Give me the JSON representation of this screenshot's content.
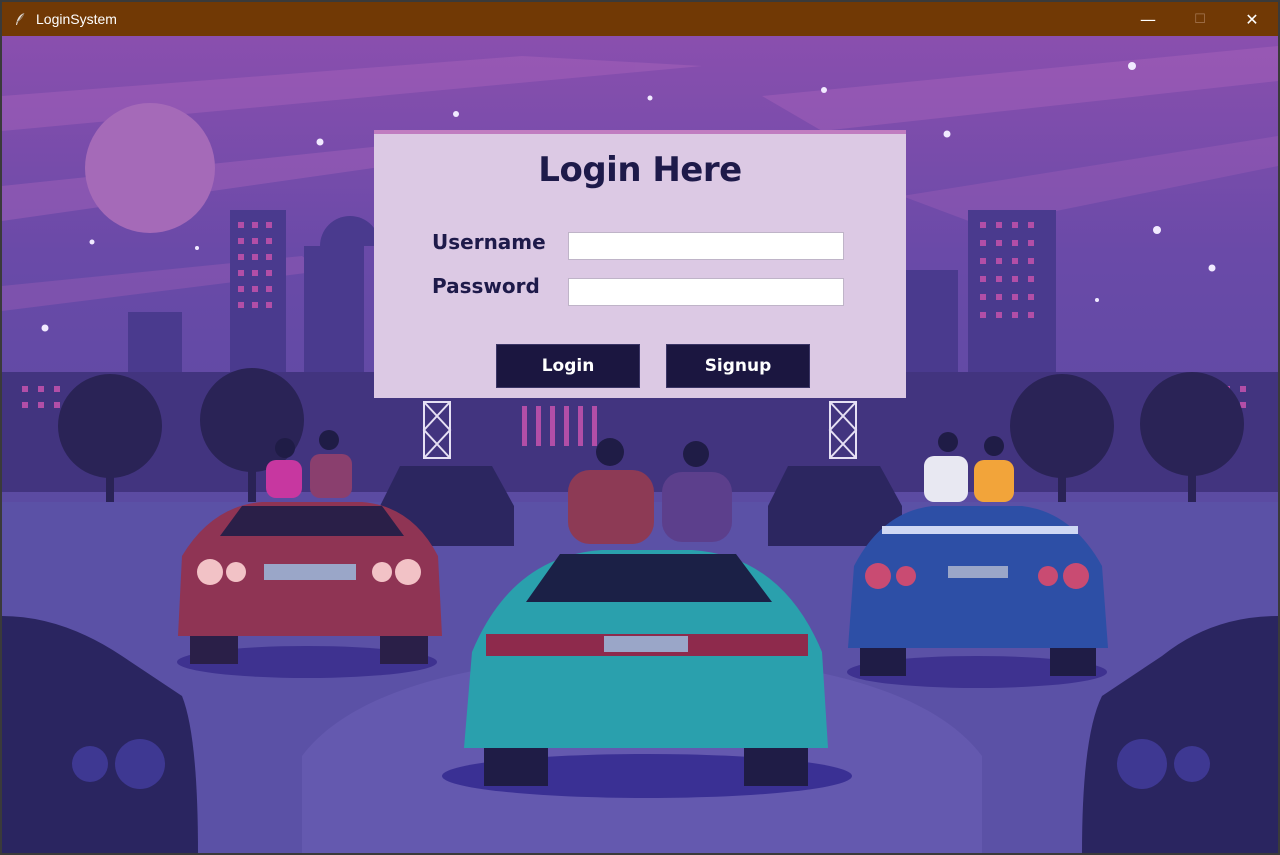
{
  "window": {
    "title": "LoginSystem",
    "minimize_glyph": "—",
    "maximize_glyph": "☐",
    "close_glyph": "✕"
  },
  "login": {
    "heading": "Login Here",
    "username_label": "Username",
    "username_value": "",
    "password_label": "Password",
    "password_value": "",
    "login_button": "Login",
    "signup_button": "Signup"
  },
  "colors": {
    "titlebar": "#713905",
    "card_background": "#dcc9e4",
    "button_background": "#1b1640",
    "text_dark": "#1e1a4a",
    "sky_top": "#7c4fa8",
    "ground": "#5a50a0"
  },
  "icons": {
    "app_icon": "feather-icon",
    "minimize": "minimize-icon",
    "maximize": "maximize-icon",
    "close": "close-icon"
  }
}
